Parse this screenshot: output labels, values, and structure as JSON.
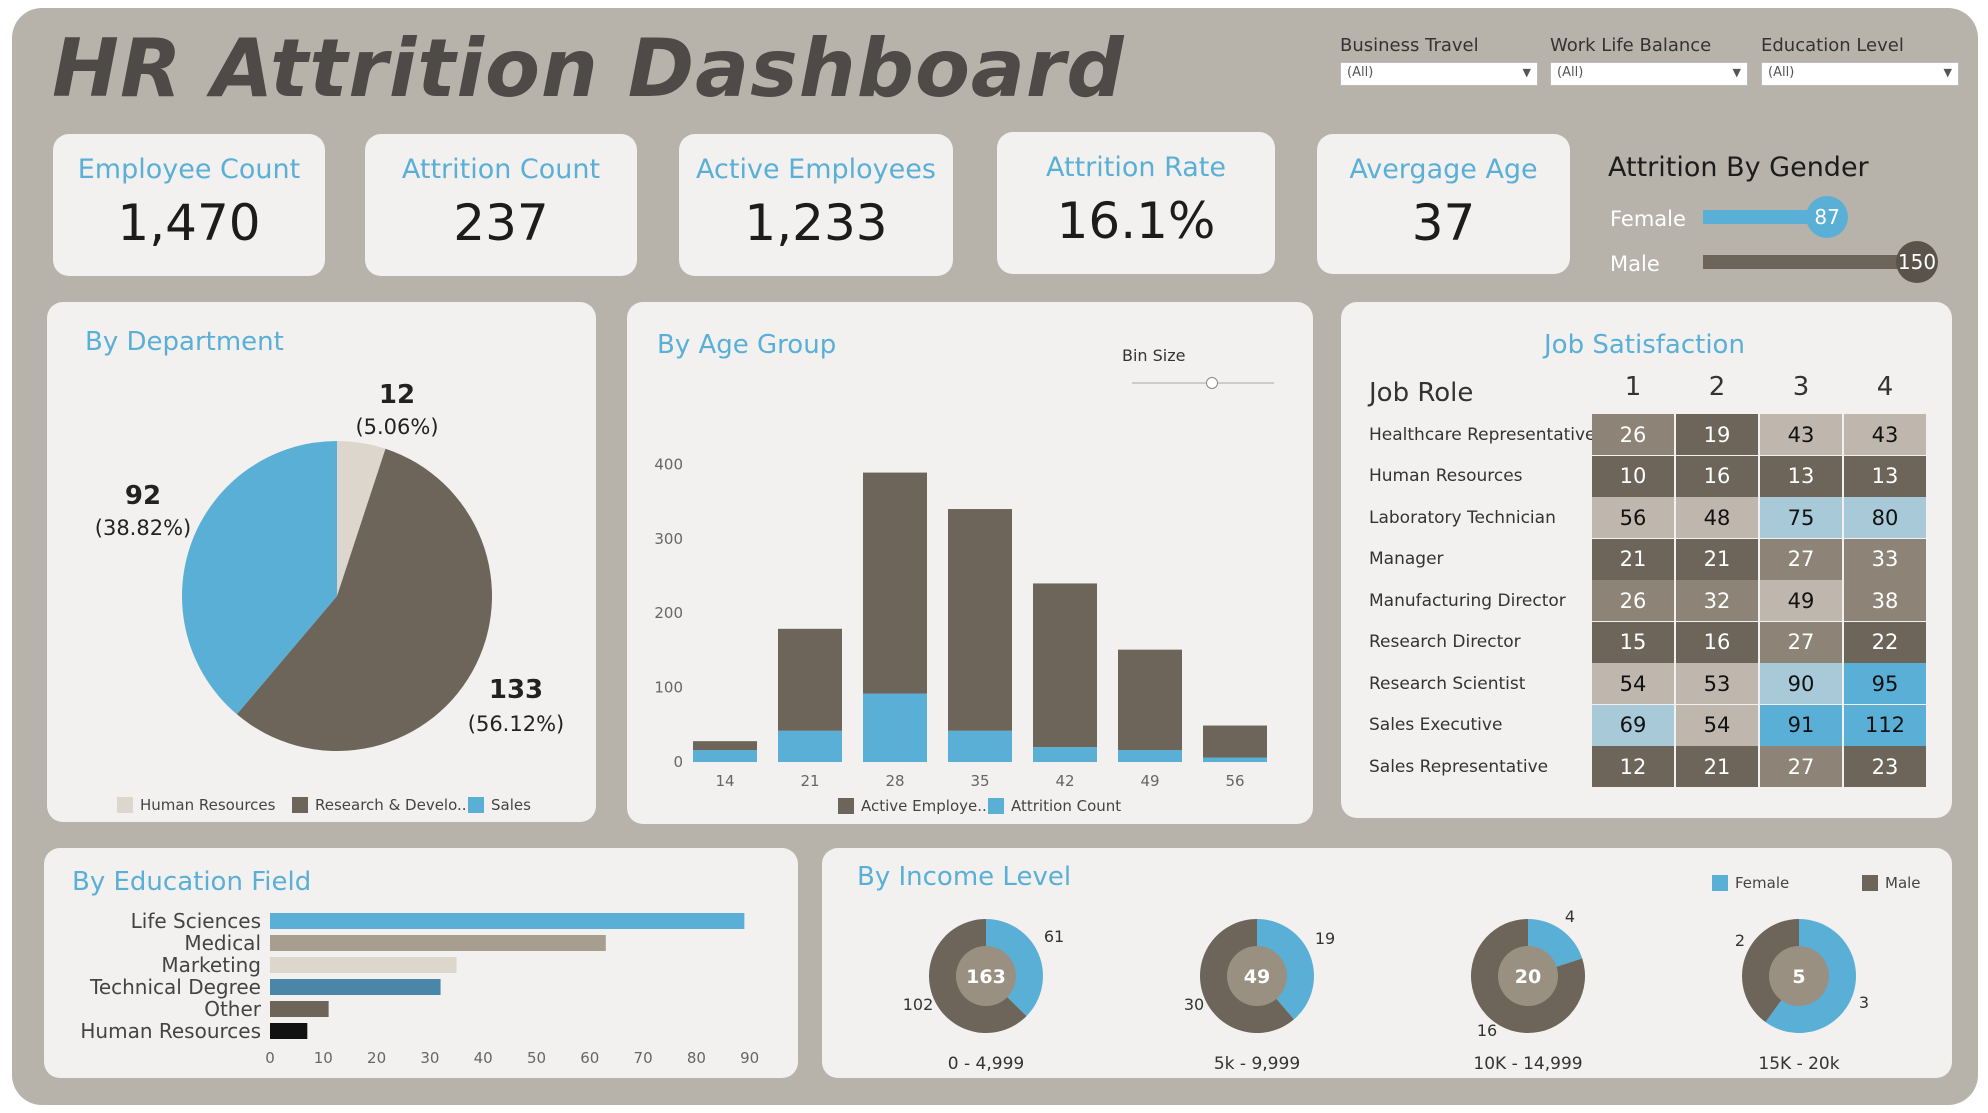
{
  "title": "HR Attrition Dashboard",
  "filters": [
    {
      "label": "Business Travel",
      "value": "(All)"
    },
    {
      "label": "Work Life Balance",
      "value": "(All)"
    },
    {
      "label": "Education Level",
      "value": "(All)"
    }
  ],
  "kpis": [
    {
      "label": "Employee Count",
      "value": "1,470"
    },
    {
      "label": "Attrition Count",
      "value": "237"
    },
    {
      "label": "Active Employees",
      "value": "1,233"
    },
    {
      "label": "Attrition Rate",
      "value": "16.1%"
    },
    {
      "label": "Avergage Age",
      "value": "37"
    }
  ],
  "colors": {
    "blue": "#5aafd6",
    "brown": "#6d655a",
    "beige": "#dcd6cc",
    "steel": "#4a86a8",
    "tan": "#a89e90",
    "black": "#111111"
  },
  "gender": {
    "title": "Attrition By Gender",
    "rows": [
      {
        "label": "Female",
        "value": 87,
        "value_text": "87"
      },
      {
        "label": "Male",
        "value": 150,
        "value_text": "150"
      }
    ]
  },
  "department": {
    "title": "By Department",
    "slice_labels": [
      {
        "count": "12",
        "pct": "(5.06%)"
      },
      {
        "count": "133",
        "pct": "(56.12%)"
      },
      {
        "count": "92",
        "pct": "(38.82%)"
      }
    ],
    "legend": [
      "Human Resources",
      "Research & Develo...",
      "Sales"
    ]
  },
  "age_group": {
    "title": "By Age Group",
    "bin_label": "Bin Size",
    "legend": [
      "Active Employe...",
      "Attrition Count"
    ],
    "y_ticks": [
      "0",
      "100",
      "200",
      "300",
      "400"
    ]
  },
  "job_satisfaction": {
    "title": "Job Satisfaction",
    "row_header": "Job Role",
    "columns": [
      "1",
      "2",
      "3",
      "4"
    ],
    "rows": [
      {
        "role": "Healthcare Representative",
        "values": [
          26,
          19,
          43,
          43
        ]
      },
      {
        "role": "Human Resources",
        "values": [
          10,
          16,
          13,
          13
        ]
      },
      {
        "role": "Laboratory Technician",
        "values": [
          56,
          48,
          75,
          80
        ]
      },
      {
        "role": "Manager",
        "values": [
          21,
          21,
          27,
          33
        ]
      },
      {
        "role": "Manufacturing Director",
        "values": [
          26,
          32,
          49,
          38
        ]
      },
      {
        "role": "Research Director",
        "values": [
          15,
          16,
          27,
          22
        ]
      },
      {
        "role": "Research Scientist",
        "values": [
          54,
          53,
          90,
          95
        ]
      },
      {
        "role": "Sales Executive",
        "values": [
          69,
          54,
          91,
          112
        ]
      },
      {
        "role": "Sales Representative",
        "values": [
          12,
          21,
          27,
          23
        ]
      }
    ]
  },
  "education": {
    "title": "By Education Field",
    "x_ticks": [
      "0",
      "10",
      "20",
      "30",
      "40",
      "50",
      "60",
      "70",
      "80",
      "90"
    ]
  },
  "income": {
    "title": "By Income Level",
    "legend": [
      "Female",
      "Male"
    ]
  },
  "chart_data": [
    {
      "type": "pie",
      "title": "By Department",
      "categories": [
        "Human Resources",
        "Research & Development",
        "Sales"
      ],
      "values": [
        12,
        133,
        92
      ],
      "percentages": [
        5.06,
        56.12,
        38.82
      ]
    },
    {
      "type": "bar",
      "title": "By Age Group",
      "categories": [
        "14",
        "21",
        "28",
        "35",
        "42",
        "49",
        "56"
      ],
      "series": [
        {
          "name": "Active Employe...",
          "values": [
            12,
            137,
            297,
            298,
            220,
            135,
            43
          ]
        },
        {
          "name": "Attrition Count",
          "values": [
            16,
            42,
            92,
            42,
            20,
            16,
            6
          ]
        }
      ],
      "stacked": true,
      "ylim": [
        0,
        450
      ]
    },
    {
      "type": "heatmap",
      "title": "Job Satisfaction",
      "x": [
        "1",
        "2",
        "3",
        "4"
      ],
      "y": [
        "Healthcare Representative",
        "Human Resources",
        "Laboratory Technician",
        "Manager",
        "Manufacturing Director",
        "Research Director",
        "Research Scientist",
        "Sales Executive",
        "Sales Representative"
      ],
      "values": [
        [
          26,
          19,
          43,
          43
        ],
        [
          10,
          16,
          13,
          13
        ],
        [
          56,
          48,
          75,
          80
        ],
        [
          21,
          21,
          27,
          33
        ],
        [
          26,
          32,
          49,
          38
        ],
        [
          15,
          16,
          27,
          22
        ],
        [
          54,
          53,
          90,
          95
        ],
        [
          69,
          54,
          91,
          112
        ],
        [
          12,
          21,
          27,
          23
        ]
      ]
    },
    {
      "type": "bar",
      "title": "By Education Field",
      "orientation": "horizontal",
      "categories": [
        "Life Sciences",
        "Medical",
        "Marketing",
        "Technical Degree",
        "Other",
        "Human Resources"
      ],
      "values": [
        89,
        63,
        35,
        32,
        11,
        7
      ],
      "xlim": [
        0,
        90
      ]
    },
    {
      "type": "pie",
      "title": "By Income Level",
      "donut": true,
      "groups": [
        {
          "label": "0 - 4,999",
          "total": 163,
          "female": 61,
          "male": 102
        },
        {
          "label": "5k - 9,999",
          "total": 49,
          "female": 19,
          "male": 30
        },
        {
          "label": "10K - 14,999",
          "total": 20,
          "female": 4,
          "male": 16
        },
        {
          "label": "15K - 20k",
          "total": 5,
          "female": 3,
          "male": 2
        }
      ],
      "legend": [
        "Female",
        "Male"
      ]
    }
  ]
}
